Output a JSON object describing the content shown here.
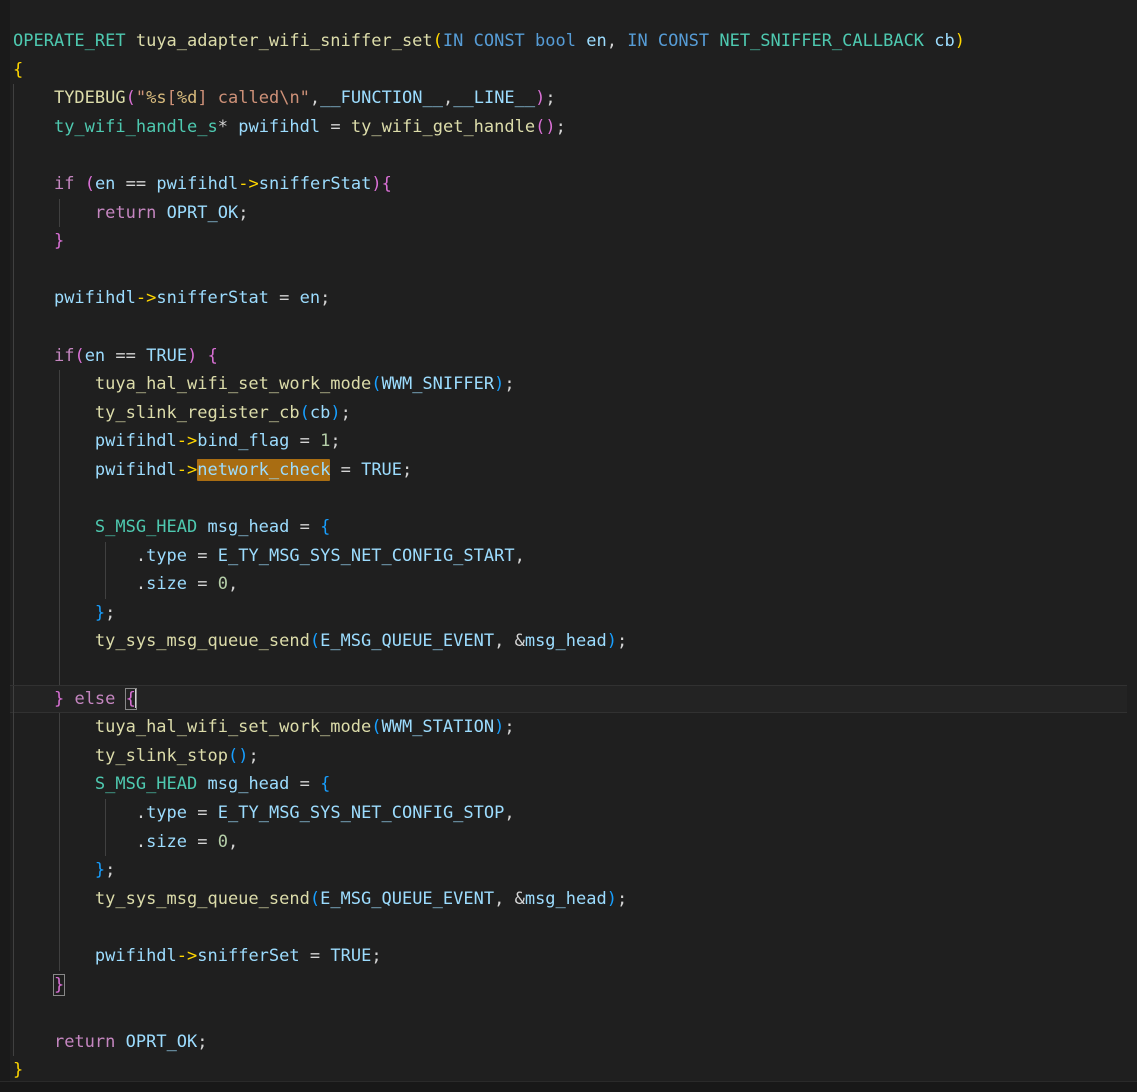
{
  "editor": {
    "app": "code-editor",
    "language": "c",
    "theme": "dark-plus",
    "colors": {
      "background": "#1f1f1f",
      "gutter": "#1a1a1a",
      "current_line": "#232323",
      "search_match_highlight": "#a96d12",
      "type": "#4ec9b0",
      "function": "#dcdcaa",
      "variable": "#9cdcfe",
      "control_keyword": "#c586c0",
      "declaration_keyword": "#569cd6",
      "number": "#b5cea8",
      "string": "#ce9178",
      "format_specifier": "#d7ba7d",
      "bracket_level_1": "#ffd700",
      "bracket_level_2": "#da70d6",
      "bracket_level_3": "#179fff",
      "indent_guide": "#404040"
    },
    "highlighted_term": "network_check",
    "current_line_text": "    } else {",
    "cursor_line_index": 24
  },
  "code": {
    "lines": [
      "OPERATE_RET tuya_adapter_wifi_sniffer_set(IN CONST bool en, IN CONST NET_SNIFFER_CALLBACK cb)",
      "{",
      "    TYDEBUG(\"%s[%d] called\\n\",__FUNCTION__,__LINE__);",
      "    ty_wifi_handle_s* pwifihdl = ty_wifi_get_handle();",
      "",
      "    if (en == pwifihdl->snifferStat){",
      "        return OPRT_OK;",
      "    }",
      "",
      "    pwifihdl->snifferStat = en;",
      "",
      "    if(en == TRUE) {",
      "        tuya_hal_wifi_set_work_mode(WWM_SNIFFER);",
      "        ty_slink_register_cb(cb);",
      "        pwifihdl->bind_flag = 1;",
      "        pwifihdl->network_check = TRUE;",
      "",
      "        S_MSG_HEAD msg_head = {",
      "            .type = E_TY_MSG_SYS_NET_CONFIG_START,",
      "            .size = 0,",
      "        };",
      "        ty_sys_msg_queue_send(E_MSG_QUEUE_EVENT, &msg_head);",
      "",
      "    } else {",
      "        tuya_hal_wifi_set_work_mode(WWM_STATION);",
      "        ty_slink_stop();",
      "        S_MSG_HEAD msg_head = {",
      "            .type = E_TY_MSG_SYS_NET_CONFIG_STOP,",
      "            .size = 0,",
      "        };",
      "        ty_sys_msg_queue_send(E_MSG_QUEUE_EVENT, &msg_head);",
      "",
      "        pwifihdl->snifferSet = TRUE;",
      "    }",
      "",
      "    return OPRT_OK;",
      "}"
    ],
    "symbols": {
      "function_name": "tuya_adapter_wifi_sniffer_set",
      "return_type": "OPERATE_RET",
      "parameters": [
        "IN CONST bool en",
        "IN CONST NET_SNIFFER_CALLBACK cb"
      ],
      "called_functions": [
        "TYDEBUG",
        "ty_wifi_get_handle",
        "tuya_hal_wifi_set_work_mode",
        "ty_slink_register_cb",
        "ty_slink_stop",
        "ty_sys_msg_queue_send"
      ],
      "types": [
        "OPERATE_RET",
        "ty_wifi_handle_s",
        "S_MSG_HEAD",
        "NET_SNIFFER_CALLBACK",
        "bool"
      ],
      "constants": [
        "OPRT_OK",
        "TRUE",
        "WWM_SNIFFER",
        "WWM_STATION",
        "E_TY_MSG_SYS_NET_CONFIG_START",
        "E_TY_MSG_SYS_NET_CONFIG_STOP",
        "E_MSG_QUEUE_EVENT",
        "__FUNCTION__",
        "__LINE__"
      ],
      "struct_fields": [
        "snifferStat",
        "bind_flag",
        "network_check",
        "snifferSet",
        "type",
        "size"
      ],
      "variables": [
        "pwifihdl",
        "en",
        "cb",
        "msg_head"
      ],
      "string_literal": "\"%s[%d] called\\n\"",
      "numbers": [
        "1",
        "0"
      ]
    }
  }
}
